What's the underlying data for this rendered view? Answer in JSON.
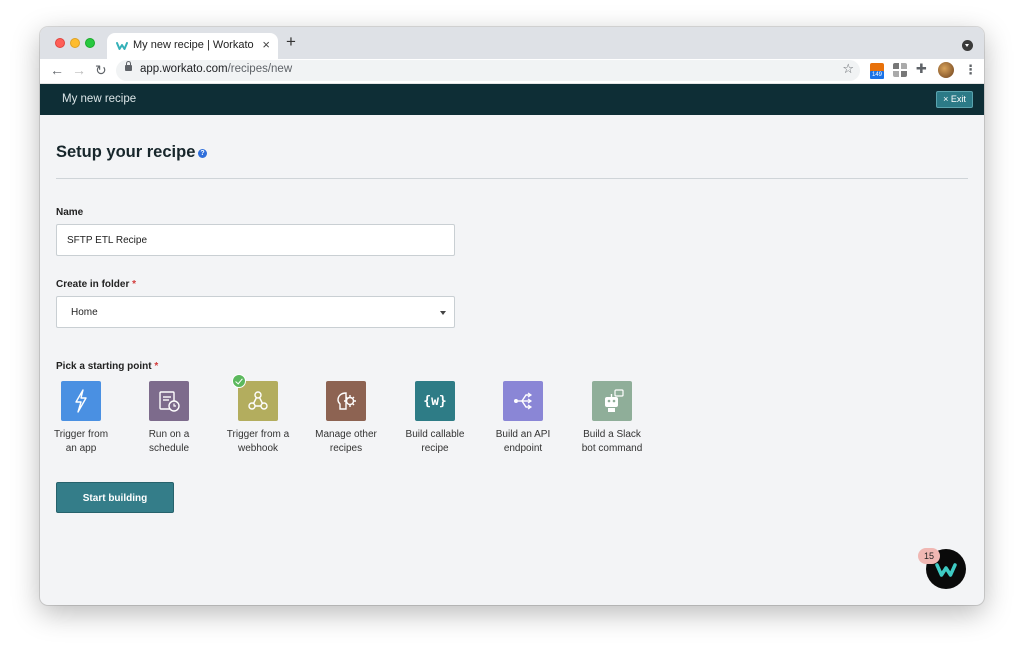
{
  "browser": {
    "tab_title": "My new recipe | Workato",
    "url_host": "app.workato.com",
    "url_path": "/recipes/new",
    "extension_badge": "149"
  },
  "header": {
    "title": "My new recipe",
    "exit_label": "Exit"
  },
  "page": {
    "title": "Setup your recipe",
    "help_label": "?"
  },
  "form": {
    "name_label": "Name",
    "name_value": "SFTP ETL Recipe",
    "folder_label": "Create in folder",
    "folder_value": "Home",
    "start_label": "Pick a starting point",
    "required_mark": "*"
  },
  "starting_points": [
    {
      "line1": "Trigger from",
      "line2": "an app",
      "icon": "lightning-icon",
      "color": "#4a90e2"
    },
    {
      "line1": "Run on a",
      "line2": "schedule",
      "icon": "schedule-icon",
      "color": "#7d6b8c"
    },
    {
      "line1": "Trigger from a",
      "line2": "webhook",
      "icon": "webhook-icon",
      "color": "#b3ad5e",
      "selected": true
    },
    {
      "line1": "Manage other",
      "line2": "recipes",
      "icon": "brain-gear-icon",
      "color": "#8d6352"
    },
    {
      "line1": "Build callable",
      "line2": "recipe",
      "icon": "braces-w-icon",
      "color": "#2e7c86"
    },
    {
      "line1": "Build an API",
      "line2": "endpoint",
      "icon": "api-endpoint-icon",
      "color": "#8a86d6"
    },
    {
      "line1": "Build a Slack",
      "line2": "bot command",
      "icon": "slack-bot-icon",
      "color": "#8fae99"
    }
  ],
  "actions": {
    "start_building": "Start building"
  },
  "assistant": {
    "count": "15"
  }
}
